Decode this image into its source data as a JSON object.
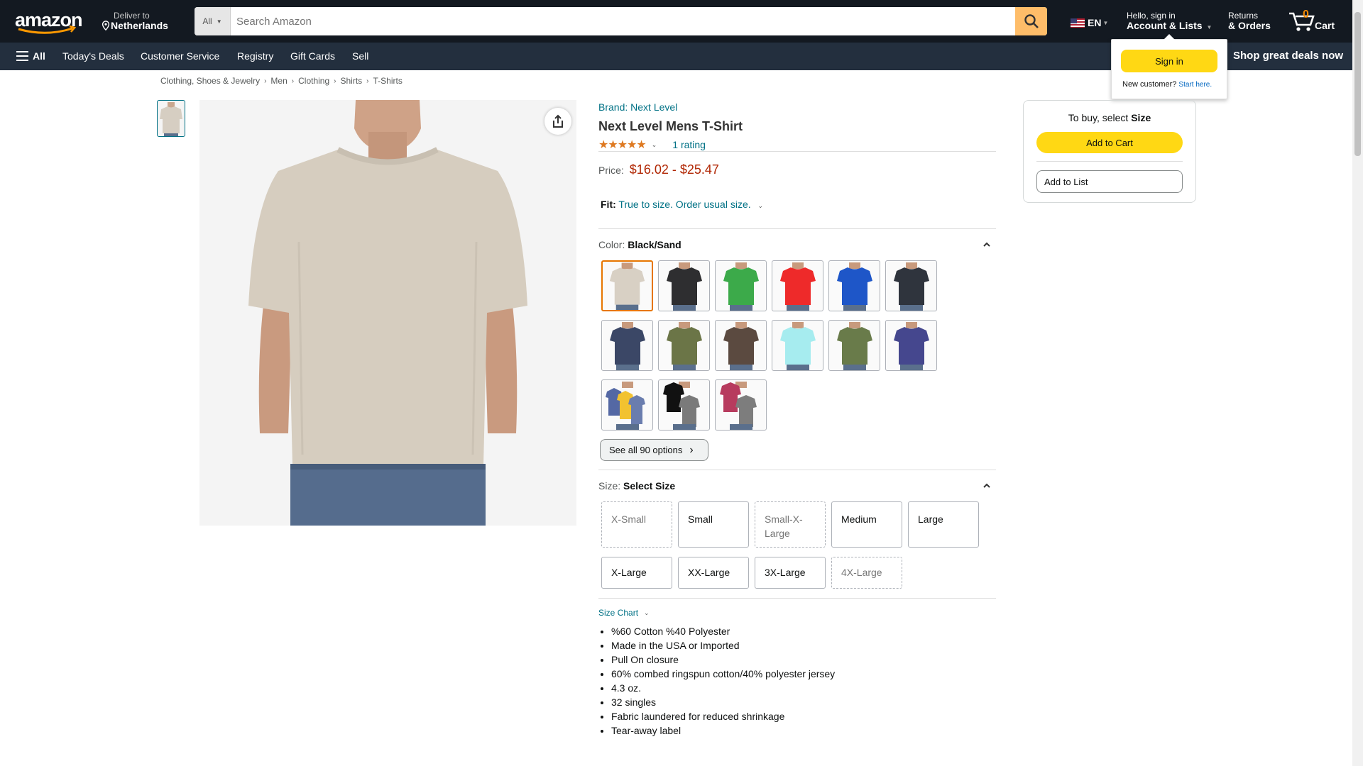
{
  "header": {
    "logo_alt": "amazon",
    "deliver": {
      "line1": "Deliver to",
      "line2": "Netherlands"
    },
    "search": {
      "department": "All",
      "placeholder": "Search Amazon"
    },
    "language": "EN",
    "account": {
      "line1": "Hello, sign in",
      "line2": "Account & Lists"
    },
    "returns": {
      "line1": "Returns",
      "line2": "& Orders"
    },
    "cart": {
      "count": "0",
      "label": "Cart"
    }
  },
  "nav": {
    "all_label": "All",
    "links": [
      "Today's Deals",
      "Customer Service",
      "Registry",
      "Gift Cards",
      "Sell"
    ],
    "promo": "Shop great deals now"
  },
  "flyout": {
    "signin_label": "Sign in",
    "new_customer": "New customer?",
    "start_here": "Start here."
  },
  "breadcrumb": [
    "Clothing, Shoes & Jewelry",
    "Men",
    "Clothing",
    "Shirts",
    "T-Shirts"
  ],
  "product": {
    "brand": "Brand: Next Level",
    "title": "Next Level Mens T-Shirt",
    "stars": "★★★★★",
    "rating_count": "1 rating",
    "price_label": "Price:",
    "price_low": "$16.02",
    "price_dash": "-",
    "price_high": "$25.47",
    "fit_label": "Fit:",
    "fit_value": "True to size. Order usual size.",
    "color_label": "Color:",
    "color_value": "Black/Sand",
    "colors": [
      {
        "name": "Sand",
        "hex": "#d8d0c4",
        "selected": true
      },
      {
        "name": "Black",
        "hex": "#2e2e30"
      },
      {
        "name": "Green",
        "hex": "#3caa4a"
      },
      {
        "name": "Red",
        "hex": "#ee2a2a"
      },
      {
        "name": "Royal",
        "hex": "#1e56c8"
      },
      {
        "name": "Charcoal",
        "hex": "#2f343d"
      },
      {
        "name": "Midnight Navy",
        "hex": "#3b4766"
      },
      {
        "name": "Military Green",
        "hex": "#6b7547"
      },
      {
        "name": "Brown",
        "hex": "#5b4a40"
      },
      {
        "name": "Light Blue",
        "hex": "#a6ecef"
      },
      {
        "name": "Olive",
        "hex": "#697b4a"
      },
      {
        "name": "Purple Navy",
        "hex": "#45478e"
      },
      {
        "name": "Multi Pack 1",
        "hex": "#f2c230"
      },
      {
        "name": "Multi Pack 2",
        "hex": "#1b1b1b"
      },
      {
        "name": "Multi Pack 3",
        "hex": "#b73b5e"
      }
    ],
    "see_all": "See all 90 options",
    "size_label": "Size:",
    "size_value": "Select Size",
    "sizes": [
      {
        "label": "X-Small",
        "available": false
      },
      {
        "label": "Small",
        "available": true
      },
      {
        "label": "Small-X-Large",
        "available": false
      },
      {
        "label": "Medium",
        "available": true
      },
      {
        "label": "Large",
        "available": true
      },
      {
        "label": "X-Large",
        "available": true
      },
      {
        "label": "XX-Large",
        "available": true
      },
      {
        "label": "3X-Large",
        "available": true
      },
      {
        "label": "4X-Large",
        "available": false
      }
    ],
    "size_chart": "Size Chart",
    "bullets": [
      "%60 Cotton %40 Polyester",
      "Made in the USA or Imported",
      "Pull On closure",
      "60% combed ringspun cotton/40% polyester jersey",
      "4.3 oz.",
      "32 singles",
      "Fabric laundered for reduced shrinkage",
      "Tear-away label"
    ]
  },
  "buybox": {
    "header_prefix": "To buy, select",
    "header_bold": "Size",
    "add_to_cart": "Add to Cart",
    "add_to_list": "Add to List"
  }
}
